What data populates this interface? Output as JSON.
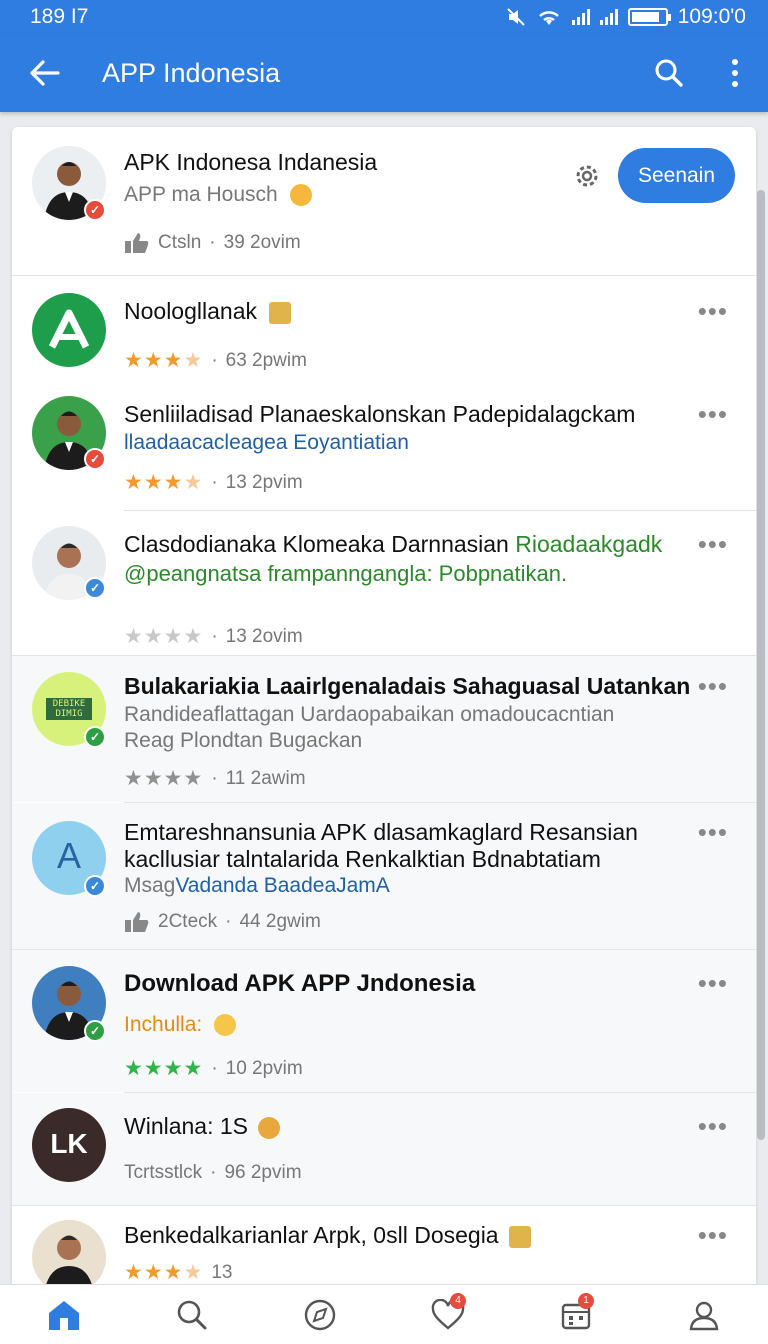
{
  "status_bar": {
    "time": "189 I7",
    "clock": "109:0'0",
    "battery_level": 0.85
  },
  "app_bar": {
    "title": "APP Indonesia"
  },
  "profile": {
    "name": "APK Indonesa Indanesia",
    "subtitle": "APP ma Housch",
    "meta_label": "Ctsln",
    "meta_time": "39 2ovim",
    "follow_label": "Seenain"
  },
  "posts": [
    {
      "title": "Noologllanak",
      "rating": 3,
      "time": "63 2pwim"
    },
    {
      "title": "Senliiladisad Planaeskalonskan Padepidalagckam",
      "subtitle": "llaadaacacleagea Eoyantiatian",
      "rating": 3,
      "time": "13 2pvim"
    },
    {
      "title_a": "Clasdodianaka Klomeaka Darnnasian",
      "title_b": "Rioadaakgadk",
      "subtitle": "@peangnatsa frampanngangla: Pobpnatikan.",
      "rating": 0,
      "time": "13 2ovim"
    },
    {
      "title": "Bulakariakia Laairlgenaladais Sahaguasal Uatankan",
      "subtitle_1": "Randideaflattagan Uardaopabaikan omadoucacntian",
      "subtitle_2": "Reag Plondtan Bugackan",
      "rating": 4,
      "time": "11 2awim",
      "logo_text": "DEBIKE DIMIG"
    },
    {
      "title_1": "Emtareshnansunia APK dlasamkaglard Resansian",
      "title_2": "kacllusiar talntalarida Renkalktian Bdnabtatiam",
      "subtitle_a": "Msag",
      "subtitle_b": "Vadanda BaadeaJamA",
      "meta_label": "2Cteck",
      "time": "44 2gwim",
      "avatar_letter": "A"
    },
    {
      "title": "Download APK APP Jndonesia",
      "subtitle": "Inchulla:",
      "rating": 4,
      "time": "10 2pvim"
    },
    {
      "title": "Winlana: 1S",
      "meta_label": "Tcrtsstlck",
      "time": "96 2pvim",
      "avatar_letter": "LK"
    },
    {
      "title": "Benkedalkarianlar Arpk, 0sll Dosegia",
      "rating": 3,
      "time": "13"
    }
  ],
  "dots_label": "•••",
  "bottom_nav": {
    "items": [
      "home-icon",
      "search-icon",
      "compass-icon",
      "heart-icon",
      "calendar-icon",
      "profile-icon"
    ],
    "heart_count": "4",
    "calendar_count": "1"
  },
  "colors": {
    "brand": "#2f7de1",
    "star_orange": "#f39a2e",
    "star_green": "#2fb54a"
  }
}
